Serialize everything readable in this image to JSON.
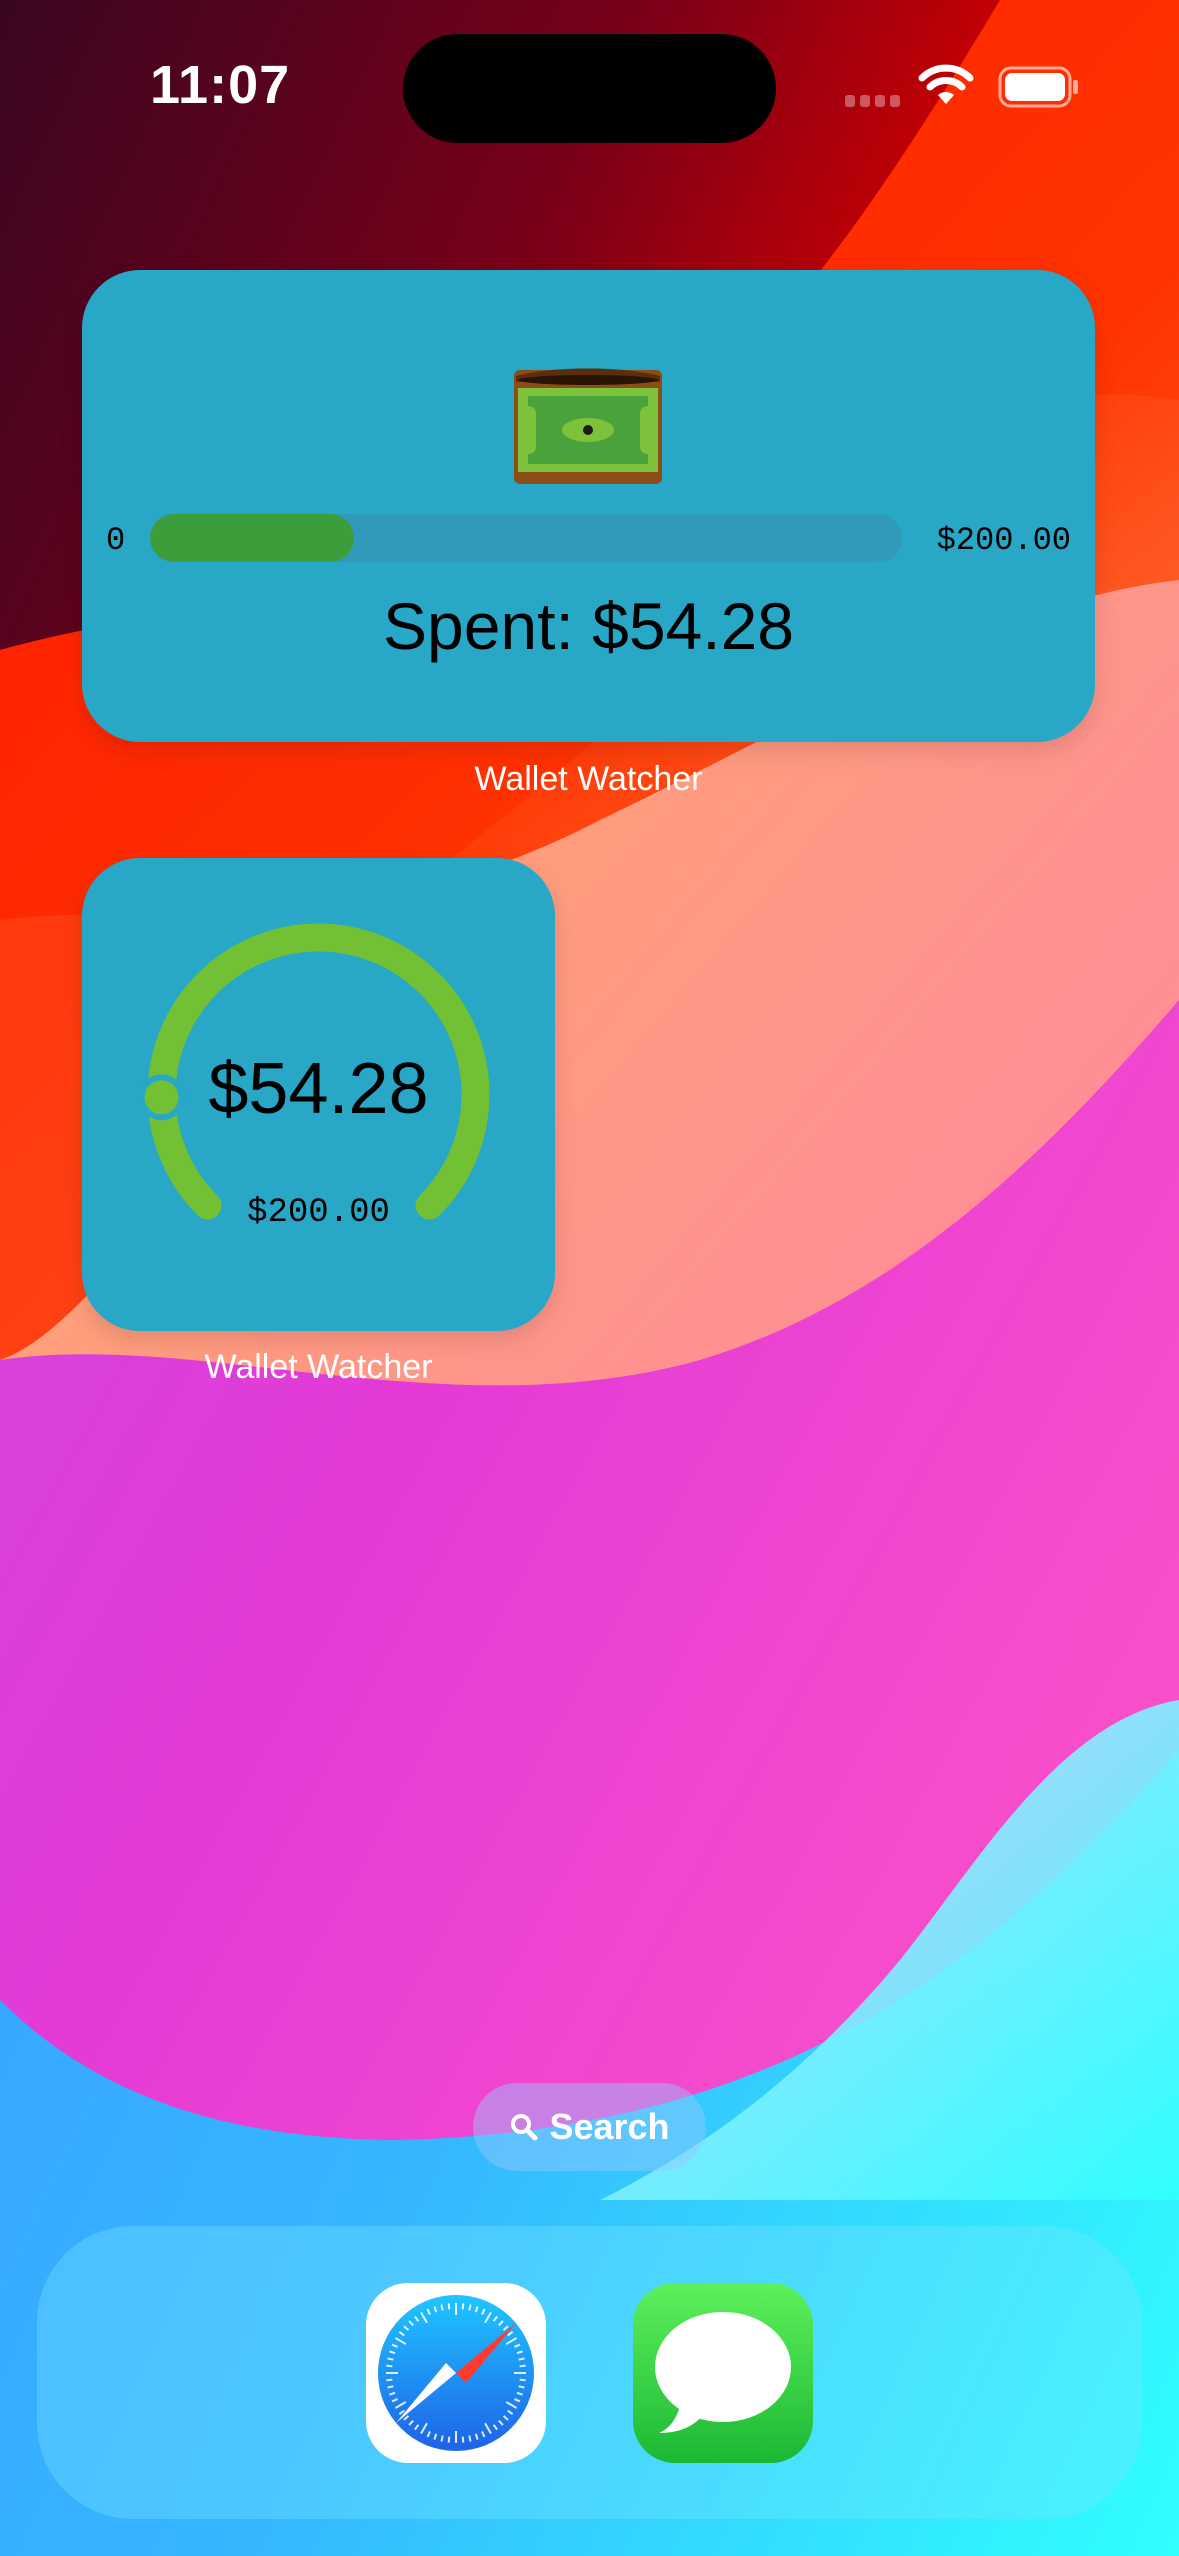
{
  "status_bar": {
    "time": "11:07"
  },
  "widgets": {
    "large": {
      "bar_min": "0",
      "bar_max": "$200.00",
      "spent_text": "Spent: $54.28",
      "progress": 0.2714,
      "caption": "Wallet Watcher",
      "icon": "wallet-cash-icon"
    },
    "small": {
      "value": "$54.28",
      "max_label": "$200.00",
      "progress": 0.2714,
      "caption": "Wallet Watcher"
    }
  },
  "search": {
    "label": "Search",
    "icon": "search-icon"
  },
  "dock": {
    "apps": [
      {
        "name": "Safari",
        "icon": "safari-compass-icon"
      },
      {
        "name": "Messages",
        "icon": "messages-bubble-icon"
      }
    ]
  },
  "colors": {
    "widget_bg": "#29a7c6",
    "bar_fill": "#3c9e3a",
    "gauge_green": "#72c034"
  }
}
